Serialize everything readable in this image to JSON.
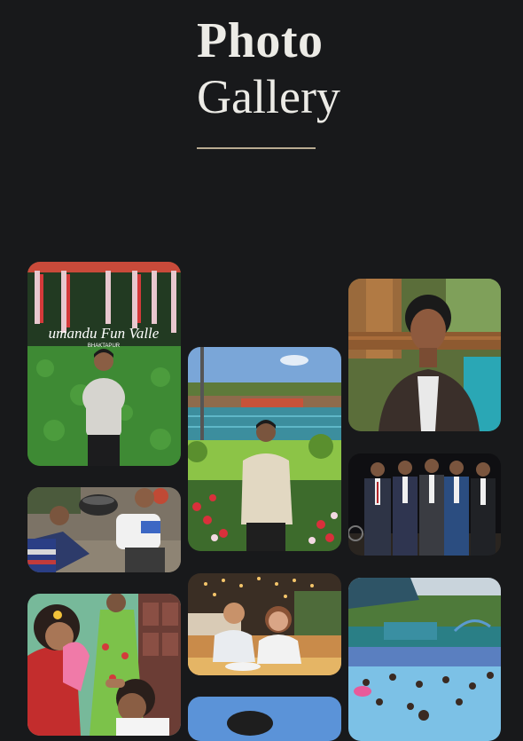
{
  "header": {
    "title_line1": "Photo",
    "title_line2": "Gallery"
  },
  "photos": [
    {
      "id": "photo-1",
      "banner_text": "umandu Fun Valle",
      "banner_subtext": "BHAKTAPUR"
    },
    {
      "id": "photo-2"
    },
    {
      "id": "photo-3"
    },
    {
      "id": "photo-4"
    },
    {
      "id": "photo-5"
    },
    {
      "id": "photo-6"
    },
    {
      "id": "photo-7"
    },
    {
      "id": "photo-8"
    },
    {
      "id": "photo-9"
    }
  ],
  "colors": {
    "background": "#18191b",
    "title": "#ecebe6",
    "accent_line": "#b8ab92"
  }
}
